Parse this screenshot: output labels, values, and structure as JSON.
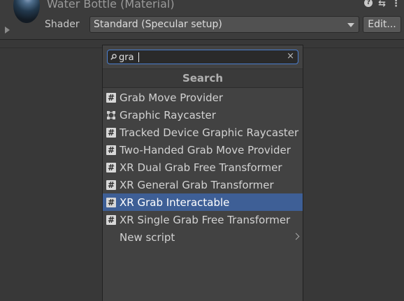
{
  "material": {
    "title": "Water Bottle (Material)",
    "shader_label": "Shader",
    "shader_value": "Standard (Specular setup)",
    "edit_label": "Edit...",
    "help_glyph": "?",
    "settings_glyph": "⇆",
    "more_glyph": "⋮"
  },
  "popup": {
    "search_value": "gra",
    "header": "Search",
    "items": [
      {
        "label": "Grab Move Provider",
        "icon": "script-icon"
      },
      {
        "label": "Graphic Raycaster",
        "icon": "rect-transform-icon"
      },
      {
        "label": "Tracked Device Graphic Raycaster",
        "icon": "script-icon"
      },
      {
        "label": "Two-Handed Grab Move Provider",
        "icon": "script-icon"
      },
      {
        "label": "XR Dual Grab Free Transformer",
        "icon": "script-icon"
      },
      {
        "label": "XR General Grab Transformer",
        "icon": "script-icon"
      },
      {
        "label": "XR Grab Interactable",
        "icon": "script-icon",
        "selected": true
      },
      {
        "label": "XR Single Grab Free Transformer",
        "icon": "script-icon"
      }
    ],
    "new_script": "New script"
  },
  "colors": {
    "selection": "#3e5f96",
    "search_focus": "#4b7fcf",
    "background": "#383838"
  }
}
